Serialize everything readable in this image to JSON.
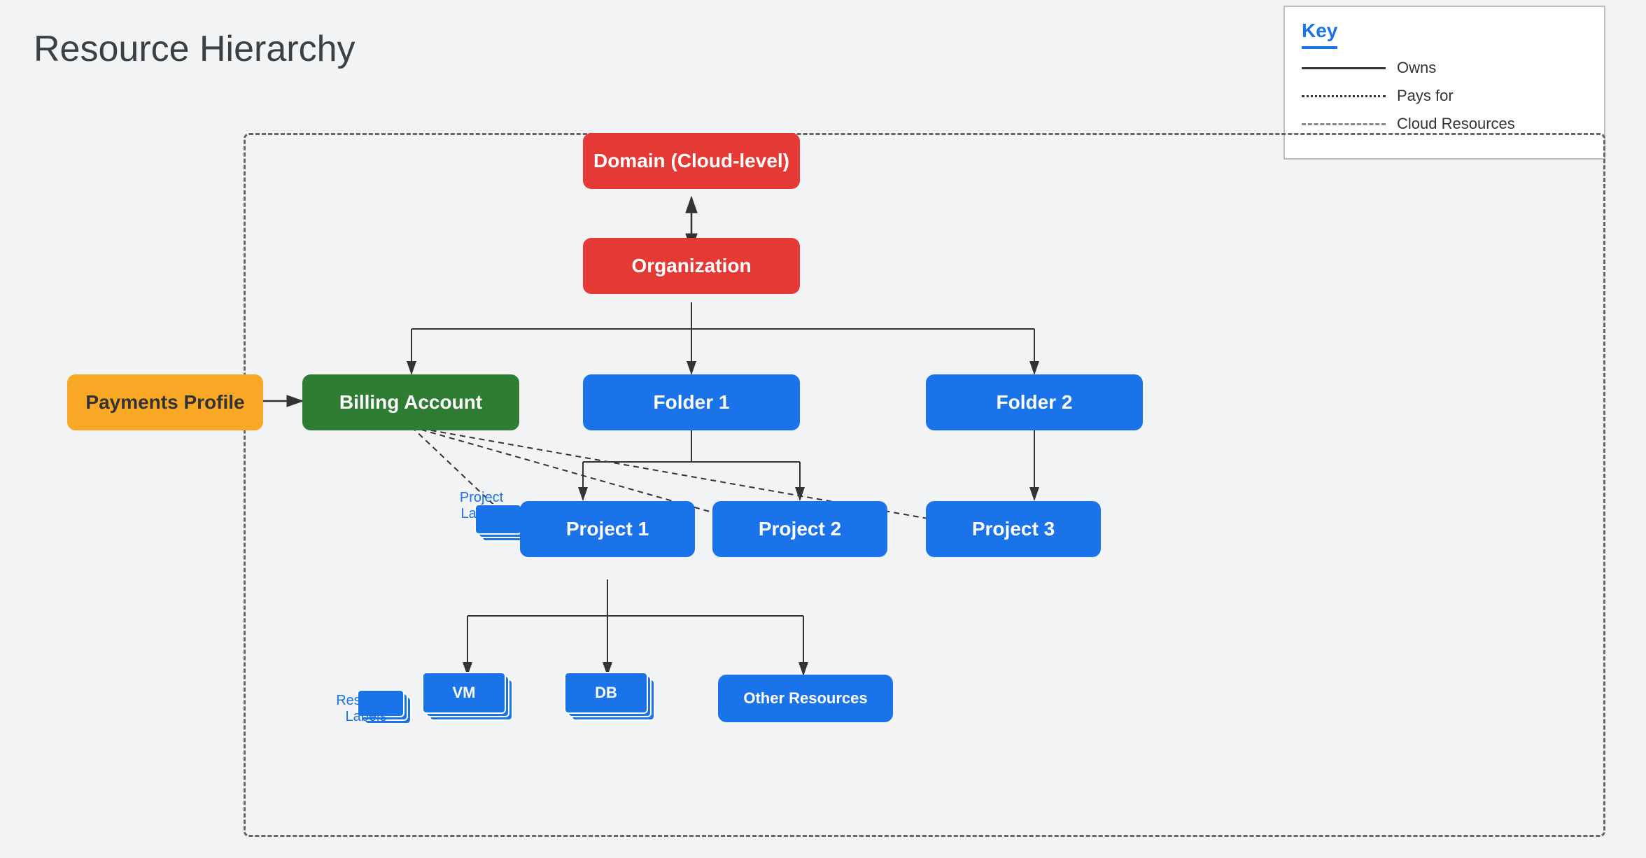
{
  "title": "Resource Hierarchy",
  "key": {
    "label": "Key",
    "items": [
      {
        "type": "solid",
        "label": "Owns"
      },
      {
        "type": "dotted",
        "label": "Pays for"
      },
      {
        "type": "dashed",
        "label": "Cloud Resources"
      }
    ]
  },
  "nodes": {
    "domain": "Domain (Cloud-level)",
    "organization": "Organization",
    "billing_account": "Billing Account",
    "payments_profile": "Payments Profile",
    "folder1": "Folder 1",
    "folder2": "Folder 2",
    "project1": "Project 1",
    "project2": "Project 2",
    "project3": "Project 3",
    "vm": "VM",
    "db": "DB",
    "other_resources": "Other Resources"
  },
  "labels": {
    "project_labels": "Project\nLabels",
    "resource_labels": "Resource\nLabels"
  }
}
